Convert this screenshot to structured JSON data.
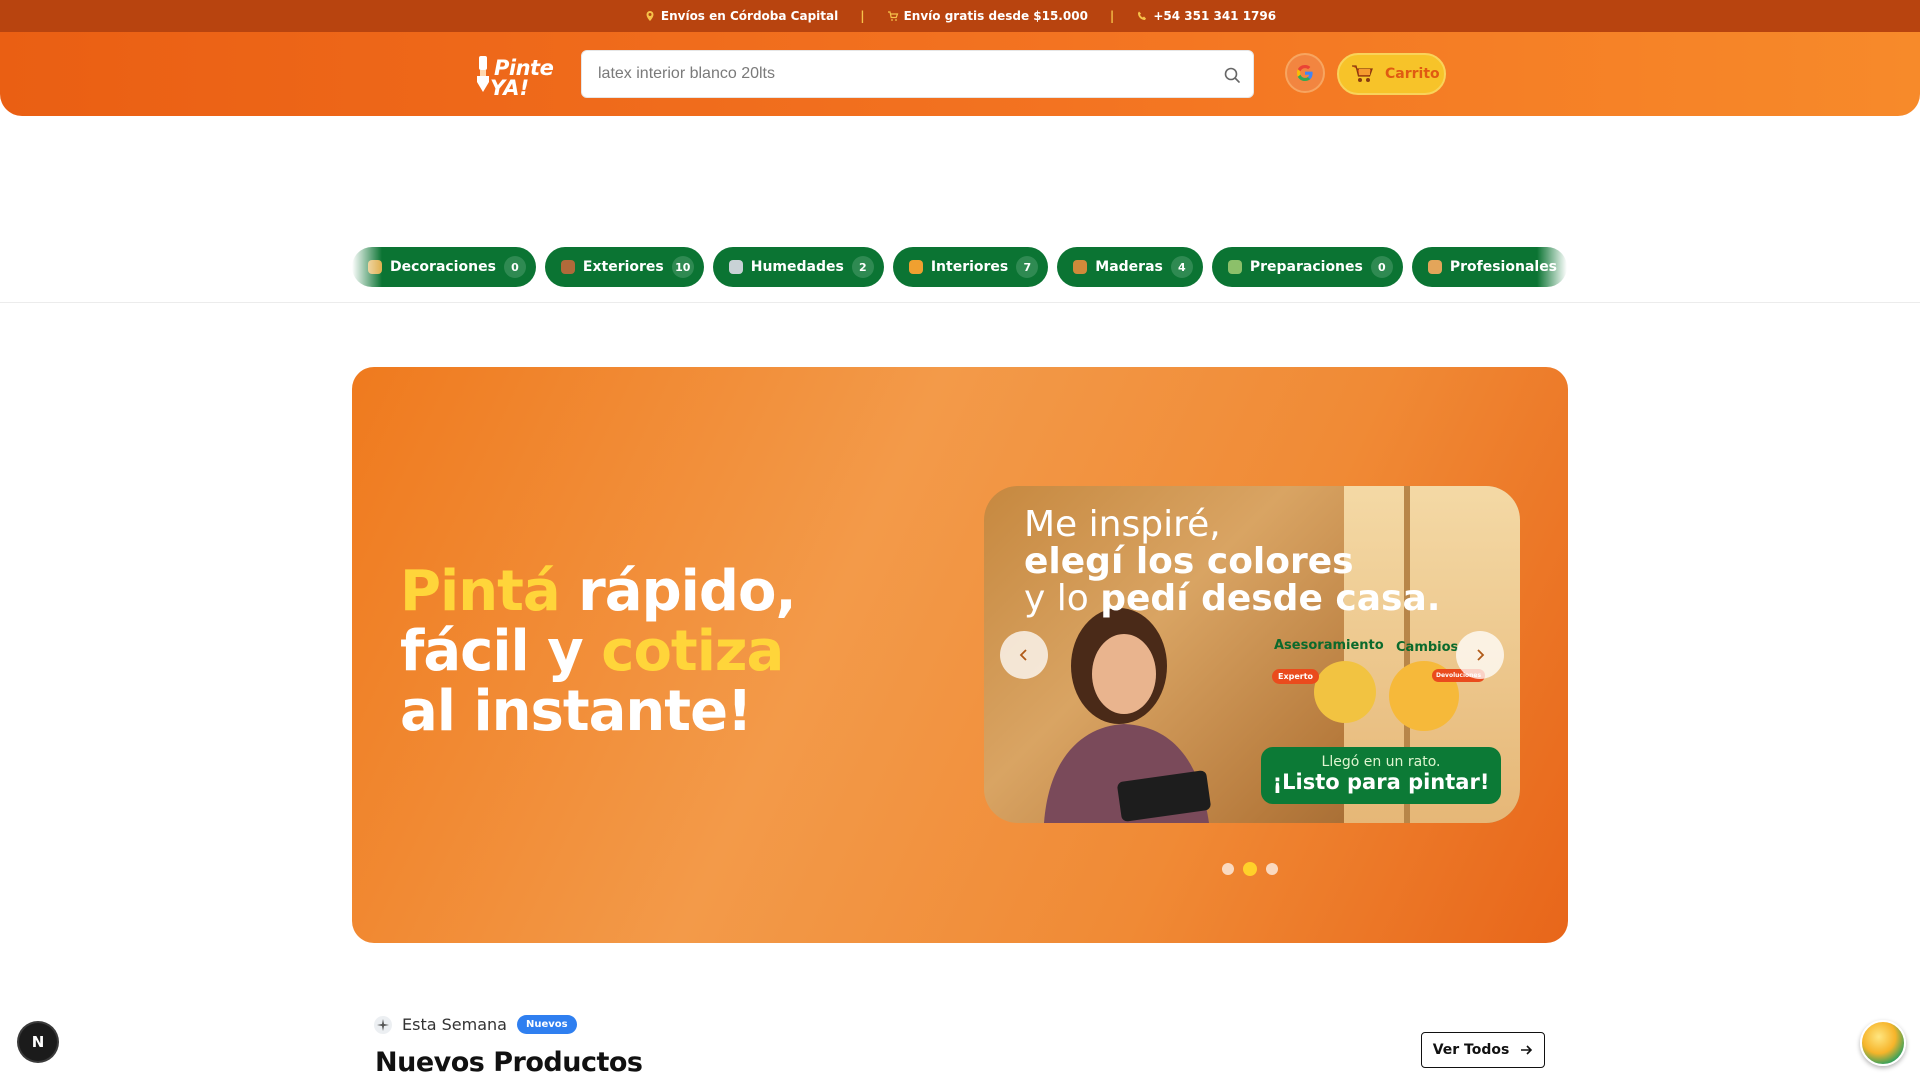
{
  "topbar": {
    "items": [
      {
        "icon": "location-pin-icon",
        "text": "Envíos en Córdoba Capital"
      },
      {
        "icon": "cart-icon",
        "text": "Envío gratis desde $15.000"
      },
      {
        "icon": "phone-icon",
        "text": "+54 351 341 1796"
      }
    ],
    "separator": "|"
  },
  "header": {
    "logo": {
      "line1": "Pinte",
      "line2": "YA!"
    },
    "search": {
      "value": "",
      "placeholder": "latex interior blanco 20lts",
      "icon": "search-icon"
    },
    "google_icon": "google-icon",
    "cart_label": "Carrito"
  },
  "categories": [
    {
      "label": "Decoraciones",
      "count": "0",
      "icon_color": "#e0b050"
    },
    {
      "label": "Exteriores",
      "count": "10",
      "icon_color": "#b06a3a"
    },
    {
      "label": "Humedades",
      "count": "2",
      "icon_color": "#c9d2d6"
    },
    {
      "label": "Interiores",
      "count": "7",
      "icon_color": "#f0a030"
    },
    {
      "label": "Maderas",
      "count": "4",
      "icon_color": "#d08a3a"
    },
    {
      "label": "Preparaciones",
      "count": "0",
      "icon_color": "#8cc06a"
    },
    {
      "label": "Profesionales",
      "count": "",
      "icon_color": "#e3a55a"
    }
  ],
  "hero": {
    "headline": {
      "w1": "Pintá",
      "w2": "rápido,",
      "w3": "fácil y",
      "w4": "cotiza",
      "w5": "al instante!"
    },
    "slide": {
      "line1": "Me inspiré,",
      "line2": "elegí los colores",
      "line3a": "y lo",
      "line3b": "pedí desde casa.",
      "label_a": "Asesoramiento",
      "label_c": "Cambios",
      "badge_a": "Experto",
      "badge_c": "Devoluciones",
      "green_l1": "Llegó en un rato.",
      "green_l2": "¡Listo para pintar!"
    },
    "dots": 3,
    "active_dot": 1
  },
  "section": {
    "tag": "Esta Semana",
    "badge": "Nuevos",
    "title": "Nuevos Productos",
    "cta": "Ver Todos"
  },
  "floating": {
    "n_button": "N"
  },
  "colors": {
    "brand_orange": "#f37321",
    "brand_green": "#0b7433",
    "accent_yellow": "#ffd53a"
  }
}
